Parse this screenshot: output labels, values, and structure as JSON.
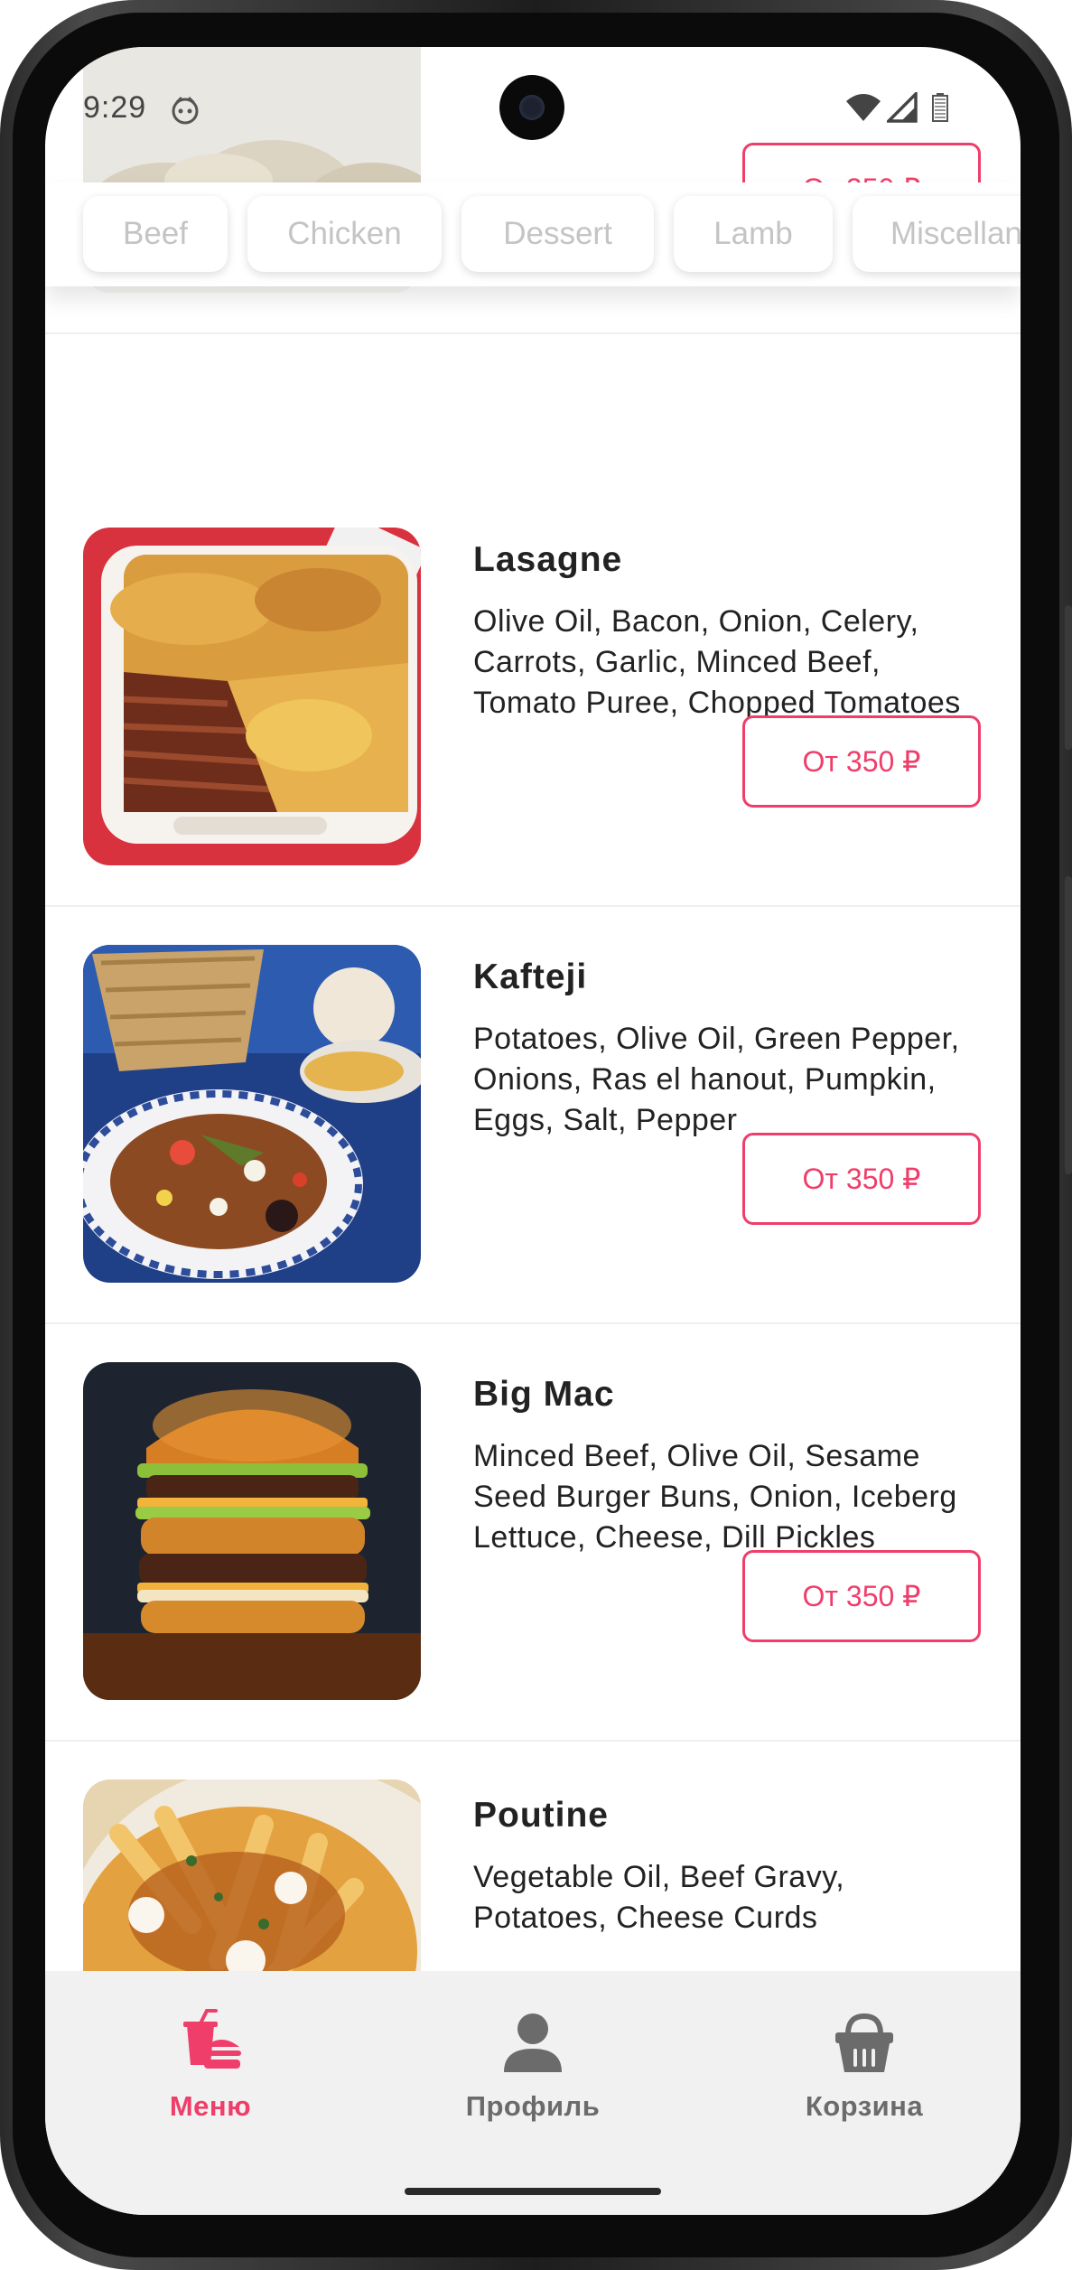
{
  "status_bar": {
    "time": "9:29"
  },
  "categories": [
    "Beef",
    "Chicken",
    "Dessert",
    "Lamb",
    "Miscellaneous"
  ],
  "menu": {
    "partial_top_item": {
      "price": "От 350 ₽"
    },
    "items": [
      {
        "title": "Lasagne",
        "description": "Olive Oil, Bacon, Onion, Celery, Carrots, Garlic, Minced Beef, Tomato Puree, Chopped Tomatoes",
        "price": "От 350 ₽"
      },
      {
        "title": "Kafteji",
        "description": "Potatoes, Olive Oil, Green Pepper, Onions, Ras el hanout, Pumpkin, Eggs, Salt, Pepper",
        "price": "От 350 ₽"
      },
      {
        "title": "Big Mac",
        "description": "Minced Beef, Olive Oil, Sesame Seed Burger Buns, Onion, Iceberg Lettuce, Cheese, Dill Pickles",
        "price": "От 350 ₽"
      },
      {
        "title": "Poutine",
        "description": "Vegetable Oil, Beef Gravy, Potatoes, Cheese Curds",
        "price": ""
      }
    ]
  },
  "bottom_nav": {
    "menu_label": "Меню",
    "profile_label": "Профиль",
    "cart_label": "Корзина"
  },
  "colors": {
    "accent": "#ef3e6a",
    "inactive": "#6b6b6b"
  }
}
